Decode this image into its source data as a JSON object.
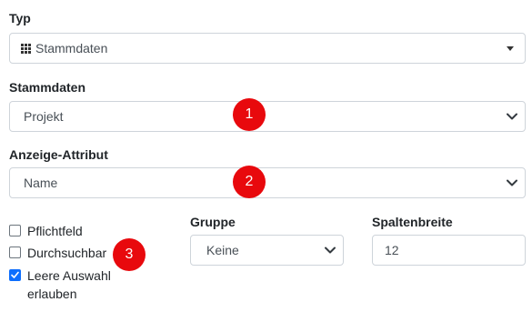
{
  "typ": {
    "label": "Typ",
    "value": "Stammdaten",
    "icon": "grid-icon"
  },
  "stammdaten": {
    "label": "Stammdaten",
    "value": "Projekt"
  },
  "anzeige": {
    "label": "Anzeige-Attribut",
    "value": "Name"
  },
  "checkboxes": [
    {
      "label": "Pflichtfeld",
      "checked": false
    },
    {
      "label": "Durchsuchbar",
      "checked": false
    },
    {
      "label_line1": "Leere Auswahl",
      "label_line2": "erlauben",
      "checked": true
    }
  ],
  "gruppe": {
    "label": "Gruppe",
    "value": "Keine"
  },
  "spaltenbreite": {
    "label": "Spaltenbreite",
    "value": "12"
  },
  "badges": [
    "1",
    "2",
    "3"
  ],
  "colors": {
    "badge": "#e8090d",
    "checkbox_checked": "#0d6efd",
    "border": "#ced4da"
  }
}
